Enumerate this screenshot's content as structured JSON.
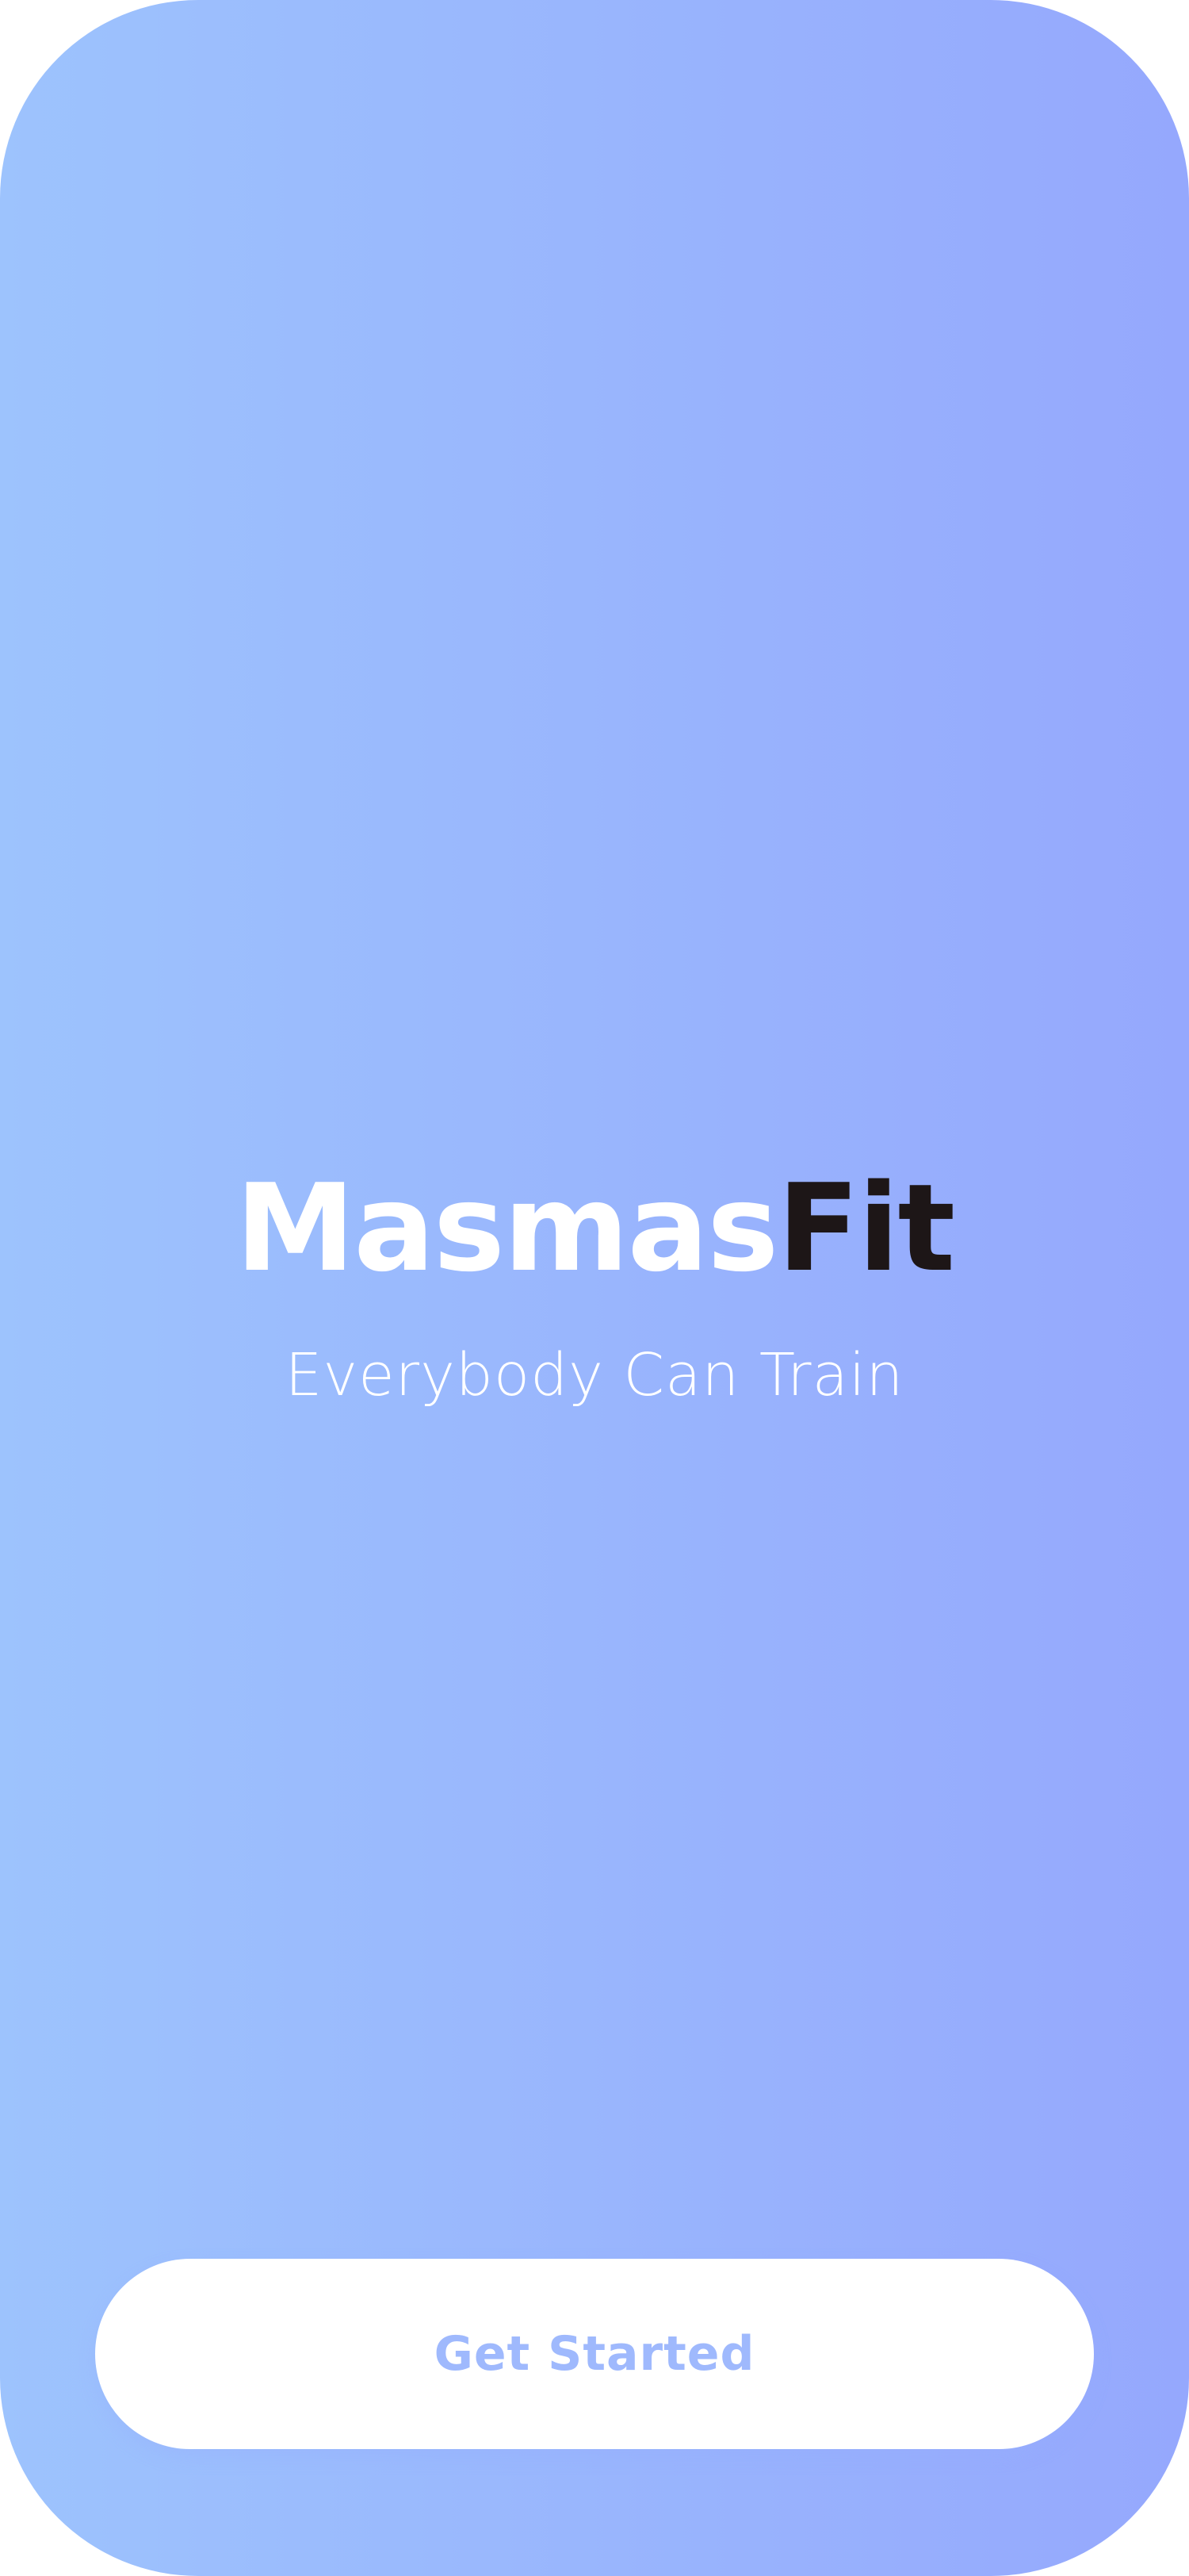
{
  "brand": {
    "part_1": "Masmas",
    "part_2": "Fit"
  },
  "tagline": "Everybody Can Train",
  "cta": {
    "label": "Get Started"
  },
  "colors": {
    "gradient_start": "#9dc3fd",
    "gradient_end": "#95a8fd",
    "brand_dark": "#1d1617",
    "button_bg": "#ffffff",
    "button_text": "#9fb9fd"
  }
}
